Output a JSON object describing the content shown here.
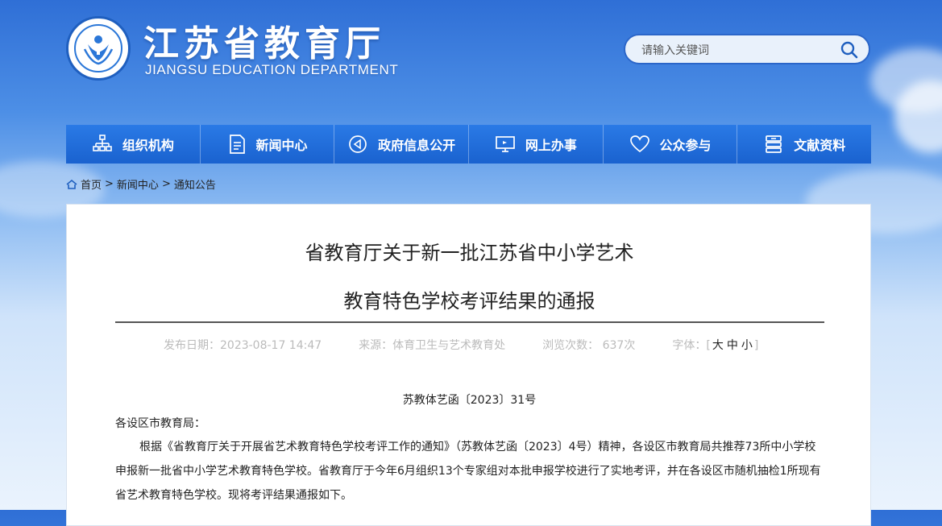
{
  "header": {
    "title": "江苏省教育厅",
    "subtitle": "JIANGSU EDUCATION DEPARTMENT",
    "search_placeholder": "请输入关键词",
    "brand_color": "#1e6ad6"
  },
  "nav": {
    "items": [
      {
        "label": "组织机构",
        "icon": "org-chart-icon"
      },
      {
        "label": "新闻中心",
        "icon": "document-icon"
      },
      {
        "label": "政府信息公开",
        "icon": "announcement-icon"
      },
      {
        "label": "网上办事",
        "icon": "monitor-icon"
      },
      {
        "label": "公众参与",
        "icon": "heart-icon"
      },
      {
        "label": "文献资料",
        "icon": "archive-icon"
      }
    ]
  },
  "breadcrumb": {
    "home": "首页",
    "sep1": ">",
    "news": "新闻中心",
    "sep2": ">",
    "current": "通知公告"
  },
  "article": {
    "title_line1": "省教育厅关于新一批江苏省中小学艺术",
    "title_line2": "教育特色学校考评结果的通报",
    "published": "发布日期：2023-08-17 14:47",
    "source": "来源：体育卫生与艺术教育处",
    "views": "浏览次数： 637次",
    "font_label": "字体：[",
    "font_large": "大",
    "font_medium": "中",
    "font_small": "小",
    "font_close": "]",
    "doc_number": "苏教体艺函〔2023〕31号",
    "salutation": "各设区市教育局：",
    "body": "根据《省教育厅关于开展省艺术教育特色学校考评工作的通知》（苏教体艺函〔2023〕4号）精神，各设区市教育局共推荐73所中小学校申报新一批省中小学艺术教育特色学校。省教育厅于今年6月组织13个专家组对本批申报学校进行了实地考评，并在各设区市随机抽检1所现有省艺术教育特色学校。现将考评结果通报如下。"
  }
}
